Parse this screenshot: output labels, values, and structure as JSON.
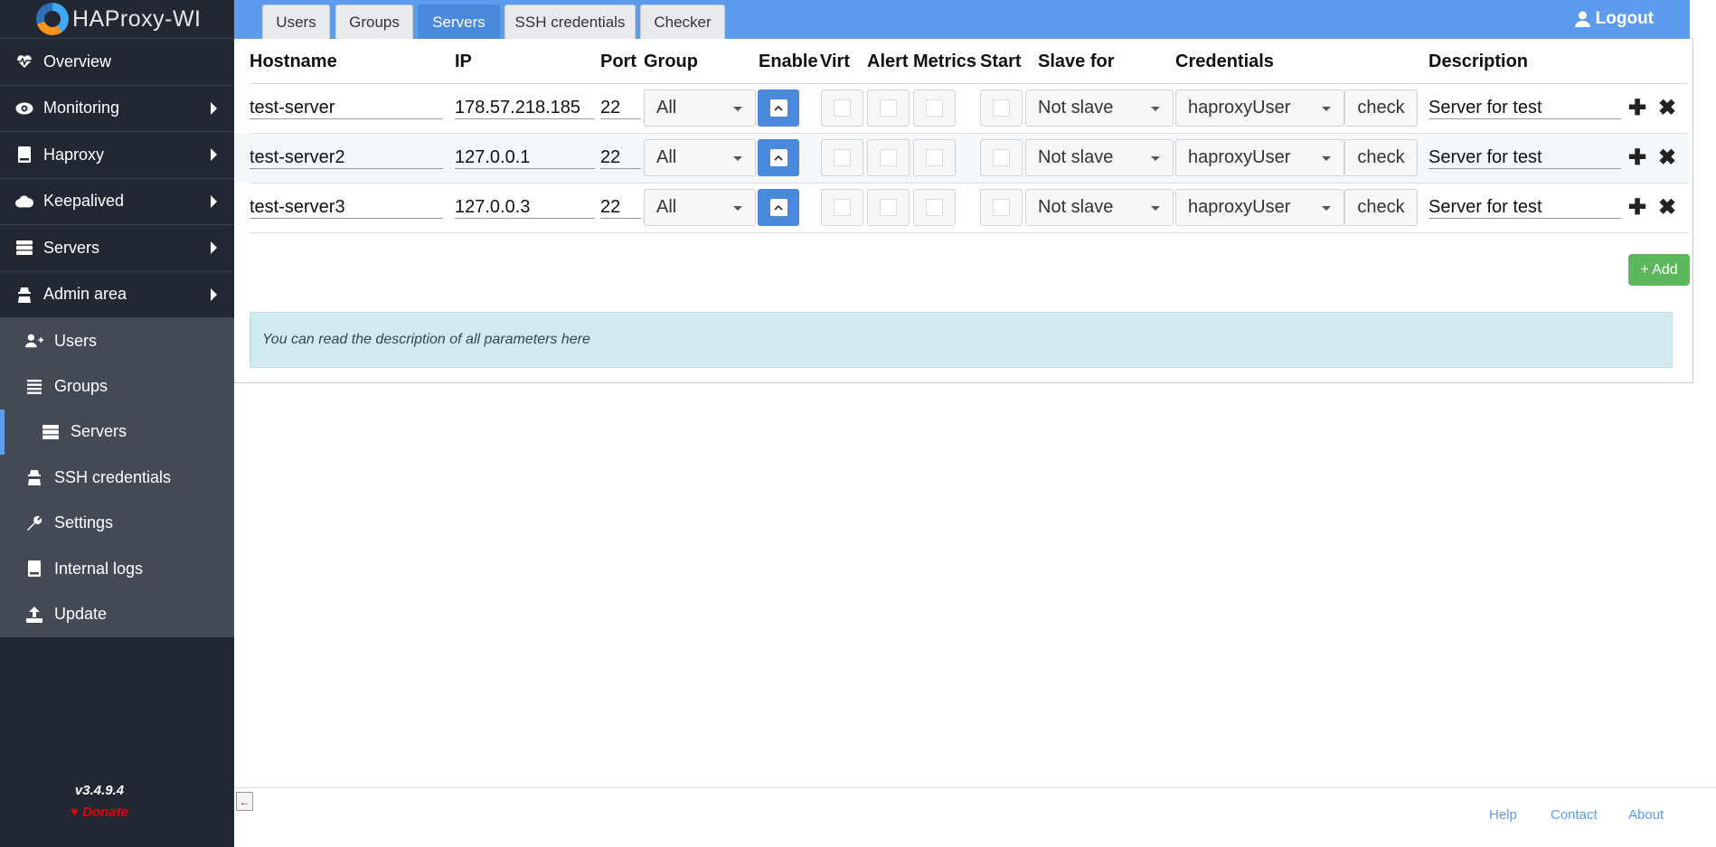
{
  "app": {
    "name": "HAProxy-WI",
    "version": "v3.4.9.4",
    "donate_label": "Donate"
  },
  "sidebar": {
    "items": [
      {
        "label": "Overview",
        "icon": "heartbeat-icon",
        "has_arrow": false
      },
      {
        "label": "Monitoring",
        "icon": "eye-icon",
        "has_arrow": true
      },
      {
        "label": "Haproxy",
        "icon": "book-icon",
        "has_arrow": true
      },
      {
        "label": "Keepalived",
        "icon": "cloud-icon",
        "has_arrow": true
      },
      {
        "label": "Servers",
        "icon": "server-icon",
        "has_arrow": true
      },
      {
        "label": "Admin area",
        "icon": "user-secret-icon",
        "has_arrow": true
      }
    ],
    "submenu": [
      {
        "label": "Users",
        "icon": "user-plus-icon"
      },
      {
        "label": "Groups",
        "icon": "list-icon"
      },
      {
        "label": "Servers",
        "icon": "server-icon",
        "active": true
      },
      {
        "label": "SSH credentials",
        "icon": "user-secret-icon"
      },
      {
        "label": "Settings",
        "icon": "wrench-icon"
      },
      {
        "label": "Internal logs",
        "icon": "book-icon"
      },
      {
        "label": "Update",
        "icon": "upload-icon"
      }
    ]
  },
  "tabs": [
    "Users",
    "Groups",
    "Servers",
    "SSH credentials",
    "Checker"
  ],
  "active_tab": "Servers",
  "logout_label": "Logout",
  "table": {
    "headers": {
      "hostname": "Hostname",
      "ip": "IP",
      "port": "Port",
      "group": "Group",
      "enable": "Enable",
      "virt": "Virt",
      "alert": "Alert",
      "metrics": "Metrics",
      "start": "Start",
      "slave_for": "Slave for",
      "credentials": "Credentials",
      "description": "Description"
    },
    "rows": [
      {
        "hostname": "test-server",
        "ip": "178.57.218.185",
        "port": "22",
        "group": "All",
        "enable": true,
        "virt": false,
        "alert": false,
        "metrics": false,
        "start": false,
        "slave_for": "Not slave",
        "credentials": "haproxyUser",
        "check": "check",
        "description": "Server for test"
      },
      {
        "hostname": "test-server2",
        "ip": "127.0.0.1",
        "port": "22",
        "group": "All",
        "enable": true,
        "virt": false,
        "alert": false,
        "metrics": false,
        "start": false,
        "slave_for": "Not slave",
        "credentials": "haproxyUser",
        "check": "check",
        "description": "Server for test"
      },
      {
        "hostname": "test-server3",
        "ip": "127.0.0.3",
        "port": "22",
        "group": "All",
        "enable": true,
        "virt": false,
        "alert": false,
        "metrics": false,
        "start": false,
        "slave_for": "Not slave",
        "credentials": "haproxyUser",
        "check": "check",
        "description": "Server for test"
      }
    ]
  },
  "add_button": "+ Add",
  "info_text": "You can read the description of all parameters here",
  "footer": {
    "links": [
      "Help",
      "Contact",
      "About"
    ]
  },
  "colors": {
    "accent": "#5d9cec",
    "sidebar_bg": "#222831",
    "submenu_bg": "#434a54",
    "add_green": "#5cb85c",
    "info_bg": "#d1eaee",
    "donate_red": "#e3000f"
  }
}
